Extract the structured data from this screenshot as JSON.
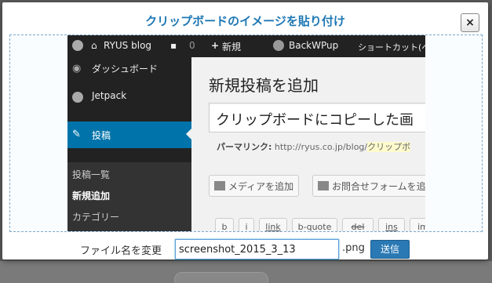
{
  "modal": {
    "title": "クリップボードのイメージを貼り付け",
    "close_label": "×"
  },
  "screenshot": {
    "adminbar": {
      "site_name": "RYUS blog",
      "comment_count": "0",
      "new_label": "新規",
      "plugin_label": "BackWPup",
      "shortcut_label": "ショートカット(ベ"
    },
    "sidebar": {
      "items": [
        {
          "label": "ダッシュボード"
        },
        {
          "label": "Jetpack"
        },
        {
          "label": "投稿"
        }
      ],
      "submenu": [
        {
          "label": "投稿一覧"
        },
        {
          "label": "新規追加"
        },
        {
          "label": "カテゴリー"
        }
      ]
    },
    "editor": {
      "heading": "新規投稿を追加",
      "title_value": "クリップボードにコピーした画",
      "permalink_label": "パーマリンク:",
      "permalink_url": "http://ryus.co.jp/blog/",
      "permalink_slug": "クリップボ",
      "add_media": "メディアを追加",
      "contact_form": "お問合せフォームを追",
      "quicktags": [
        "b",
        "i",
        "link",
        "b-quote",
        "del",
        "ins",
        "im"
      ]
    }
  },
  "footer": {
    "filename_label": "ファイル名を変更",
    "filename_value": "screenshot_2015_3_13",
    "extension": ".png",
    "send_label": "送信"
  },
  "colors": {
    "title": "#1e78b4",
    "admin_dark": "#222222",
    "active_menu": "#0073aa",
    "send_button": "#2a79b4"
  }
}
